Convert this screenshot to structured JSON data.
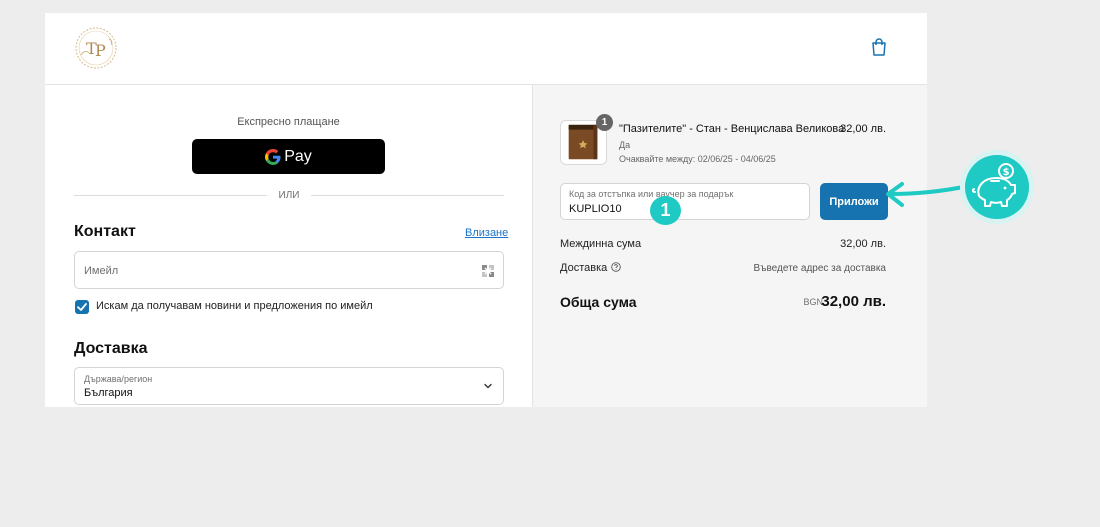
{
  "express": {
    "label": "Експресно плащане",
    "gpay_label": "Pay",
    "or_label": "ИЛИ"
  },
  "contact": {
    "title": "Контакт",
    "login_link": "Влизане",
    "email_placeholder": "Имейл",
    "newsletter_label": "Искам да получавам новини и предложения по имейл",
    "newsletter_checked": true
  },
  "delivery": {
    "title": "Доставка",
    "country_label": "Държава/регион",
    "country_value": "България"
  },
  "order": {
    "item": {
      "quantity": "1",
      "name": "\"Пазителите\" - Стан - Венцислава Великова",
      "price": "32,00 лв.",
      "variant": "Да",
      "delivery_estimate": "Очаквайте между: 02/06/25 - 04/06/25"
    },
    "discount": {
      "label": "Код за отстъпка или ваучер за подарък",
      "value": "KUPLIO10",
      "apply_label": "Приложи"
    },
    "subtotal_label": "Междинна сума",
    "subtotal_value": "32,00 лв.",
    "shipping_label": "Доставка",
    "shipping_value": "Въведете адрес за доставка",
    "total_label": "Обща сума",
    "total_currency": "BGN",
    "total_value": "32,00 лв."
  },
  "annotation": {
    "step_number": "1",
    "accent_color": "#1fc9c4"
  },
  "colors": {
    "primary_button": "#1773b0",
    "gpay_button": "#000000"
  },
  "icons": {
    "logo": "tp-monogram-logo",
    "cart": "shopping-bag-icon",
    "autofill": "autofill-icon",
    "help": "question-circle-icon",
    "chevron": "chevron-down-icon",
    "piggy": "piggy-bank-icon"
  }
}
